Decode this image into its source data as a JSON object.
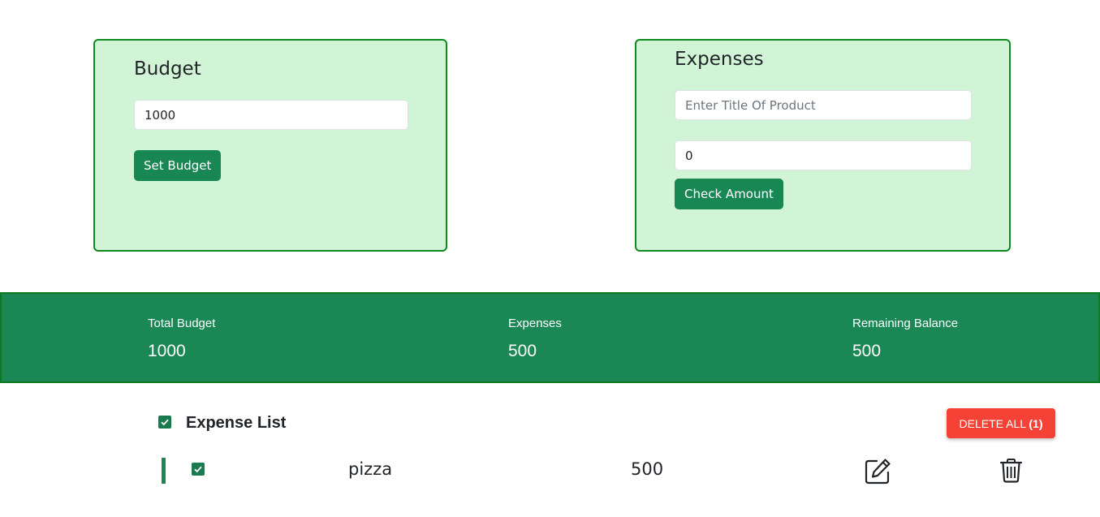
{
  "budget_card": {
    "title": "Budget",
    "input_value": "1000",
    "button_label": "Set Budget"
  },
  "expenses_card": {
    "title": "Expenses",
    "title_placeholder": "Enter Title Of Product",
    "amount_value": "0",
    "button_label": "Check Amount"
  },
  "summary": {
    "total_budget_label": "Total Budget",
    "total_budget_value": "1000",
    "expenses_label": "Expenses",
    "expenses_value": "500",
    "remaining_label": "Remaining Balance",
    "remaining_value": "500"
  },
  "expense_list": {
    "title": "Expense List",
    "delete_all_label": "DELETE ALL",
    "delete_all_count": "(1)",
    "items": [
      {
        "name": "pizza",
        "amount": "500"
      }
    ]
  },
  "icons": {
    "header_checkbox": "checkbox-checked-icon",
    "row_checkbox": "checkbox-checked-icon",
    "edit": "edit-pencil-icon",
    "delete": "trash-icon"
  },
  "colors": {
    "card_background": "#d1f3d6",
    "card_border": "#0f8a1f",
    "primary_green": "#198754",
    "summary_bar": "#1b8754",
    "danger": "#f44336"
  }
}
